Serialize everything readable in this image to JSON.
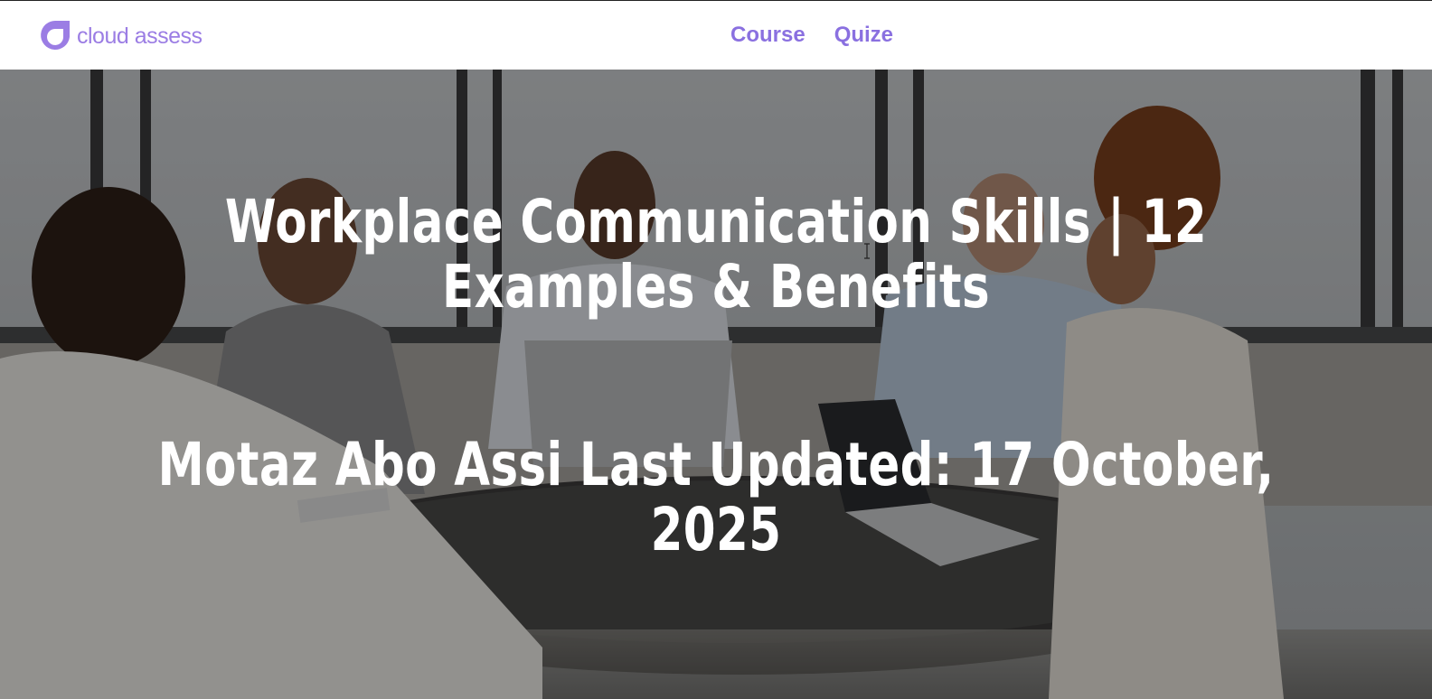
{
  "header": {
    "logo_text": "cloud assess",
    "nav": [
      {
        "label": "Course"
      },
      {
        "label": "Quize"
      }
    ]
  },
  "hero": {
    "title": "Workplace Communication Skills | 12 Examples & Benefits",
    "meta": "Motaz Abo Assi Last Updated: 17 October, 2025",
    "image": "office-meeting-photo"
  },
  "colors": {
    "brand": "#9b7de4",
    "nav_link": "#8a70e0",
    "hero_text": "#ffffff"
  }
}
